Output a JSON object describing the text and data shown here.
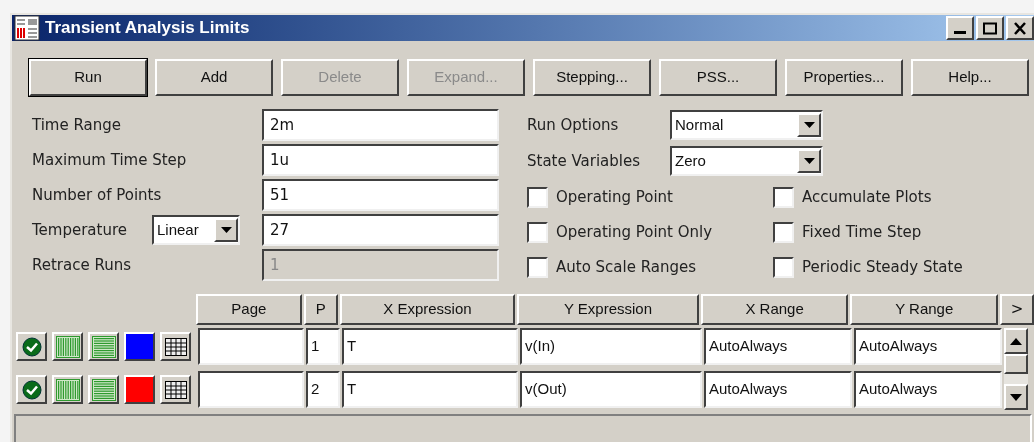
{
  "window": {
    "title": "Transient Analysis Limits"
  },
  "buttons": [
    {
      "label": "Run",
      "default": true,
      "disabled": false
    },
    {
      "label": "Add",
      "default": false,
      "disabled": false
    },
    {
      "label": "Delete",
      "default": false,
      "disabled": true
    },
    {
      "label": "Expand...",
      "default": false,
      "disabled": true
    },
    {
      "label": "Stepping...",
      "default": false,
      "disabled": false
    },
    {
      "label": "PSS...",
      "default": false,
      "disabled": false
    },
    {
      "label": "Properties...",
      "default": false,
      "disabled": false
    },
    {
      "label": "Help...",
      "default": false,
      "disabled": false
    }
  ],
  "fields": [
    {
      "label": "Time Range",
      "value": "2m",
      "disabled": false
    },
    {
      "label": "Maximum Time Step",
      "value": "1u",
      "disabled": false
    },
    {
      "label": "Number of Points",
      "value": "51",
      "disabled": false
    },
    {
      "label": "Temperature",
      "mode": "Linear",
      "value": "27",
      "disabled": false
    },
    {
      "label": "Retrace Runs",
      "value": "1",
      "disabled": true
    }
  ],
  "options": [
    {
      "label": "Run Options",
      "value": "Normal"
    },
    {
      "label": "State Variables",
      "value": "Zero"
    }
  ],
  "checkboxes": [
    {
      "label": "Operating Point",
      "checked": false
    },
    {
      "label": "Accumulate Plots",
      "checked": false
    },
    {
      "label": "Operating Point Only",
      "checked": false
    },
    {
      "label": "Fixed Time Step",
      "checked": false
    },
    {
      "label": "Auto Scale Ranges",
      "checked": false
    },
    {
      "label": "Periodic Steady State",
      "checked": false
    }
  ],
  "table": {
    "columns": [
      "Page",
      "P",
      "X Expression",
      "Y Expression",
      "X Range",
      "Y Range"
    ],
    "more": ">",
    "rows": [
      {
        "enabled": true,
        "color": "#0000ff",
        "cells": [
          "",
          "1",
          "T",
          "v(In)",
          "AutoAlways",
          "AutoAlways"
        ]
      },
      {
        "enabled": true,
        "color": "#ff0000",
        "cells": [
          "",
          "2",
          "T",
          "v(Out)",
          "AutoAlways",
          "AutoAlways"
        ]
      }
    ]
  }
}
